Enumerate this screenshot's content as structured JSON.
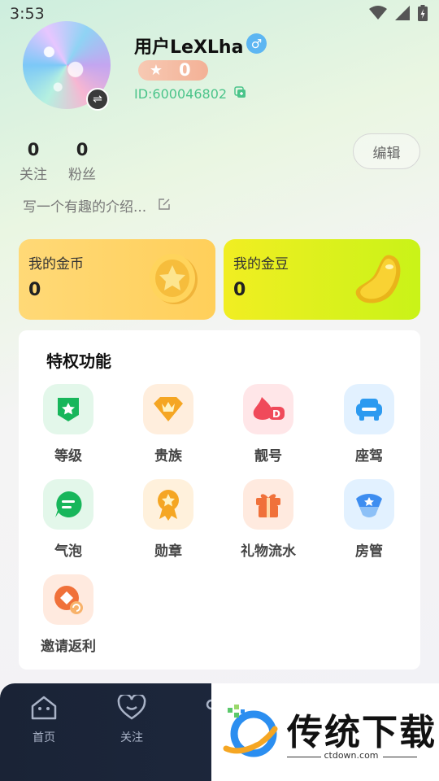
{
  "status_bar": {
    "time": "3:53"
  },
  "profile": {
    "username": "用户LeXLha",
    "level": "0",
    "user_id": "ID:600046802",
    "following_count": "0",
    "following_label": "关注",
    "fans_count": "0",
    "fans_label": "粉丝",
    "edit_label": "编辑",
    "bio_placeholder": "写一个有趣的介绍..."
  },
  "wallet": {
    "coins_title": "我的金币",
    "coins_value": "0",
    "beans_title": "我的金豆",
    "beans_value": "0"
  },
  "privileges": {
    "title": "特权功能",
    "items": [
      {
        "label": "等级",
        "icon": "level-shield-icon",
        "bg": "#e3f7ea",
        "color": "#18b65b"
      },
      {
        "label": "贵族",
        "icon": "diamond-crown-icon",
        "bg": "#ffeedd",
        "color": "#f5a623"
      },
      {
        "label": "靓号",
        "icon": "flame-id-icon",
        "bg": "#ffe6e8",
        "color": "#f04a5a"
      },
      {
        "label": "座驾",
        "icon": "car-icon",
        "bg": "#e2f1ff",
        "color": "#2c9af0"
      },
      {
        "label": "气泡",
        "icon": "chat-bubble-icon",
        "bg": "#e3f7ea",
        "color": "#18b65b"
      },
      {
        "label": "勋章",
        "icon": "medal-icon",
        "bg": "#fff1dc",
        "color": "#f5a623"
      },
      {
        "label": "礼物流水",
        "icon": "gift-icon",
        "bg": "#ffeadf",
        "color": "#f0713a"
      },
      {
        "label": "房管",
        "icon": "police-cap-icon",
        "bg": "#e2f1ff",
        "color": "#3d8df0"
      },
      {
        "label": "邀请返利",
        "icon": "rebate-icon",
        "bg": "#ffeadf",
        "color": "#f0713a"
      }
    ]
  },
  "tabbar": {
    "tabs": [
      {
        "label": "首页",
        "icon": "home-icon"
      },
      {
        "label": "关注",
        "icon": "heart-chat-icon"
      }
    ]
  },
  "watermark": {
    "brand": "传统下载",
    "url": "ctdown.com"
  }
}
